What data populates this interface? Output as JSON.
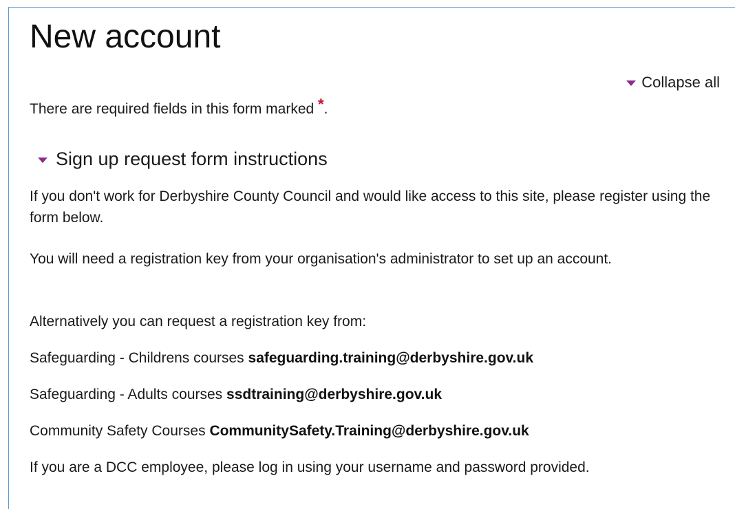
{
  "page": {
    "title": "New account",
    "collapse_all_label": "Collapse all",
    "required_notice": "There are required fields in this form marked",
    "required_marker": "*",
    "required_period": "."
  },
  "section": {
    "heading": "Sign up request form instructions",
    "paragraphs": {
      "p1": "If you don't work for Derbyshire County Council and would like access to this site, please register using the form below.",
      "p2": "You will need a registration key from your organisation's administrator to set up an account.",
      "p3": "Alternatively you can request a registration key from:",
      "p7": "If you are a DCC employee, please log in using your username and password provided."
    },
    "contacts": [
      {
        "label": "Safeguarding - Childrens courses ",
        "email": "safeguarding.training@derbyshire.gov.uk"
      },
      {
        "label": "Safeguarding - Adults courses ",
        "email": "ssdtraining@derbyshire.gov.uk"
      },
      {
        "label": "Community Safety Courses ",
        "email": "CommunitySafety.Training@derbyshire.gov.uk"
      }
    ]
  },
  "colors": {
    "accent": "#8e2a8f",
    "required": "#c8102e",
    "frame": "#5b9bd5"
  },
  "icons": {
    "collapse_all": "caret-down-icon",
    "section_toggle": "caret-down-icon"
  }
}
